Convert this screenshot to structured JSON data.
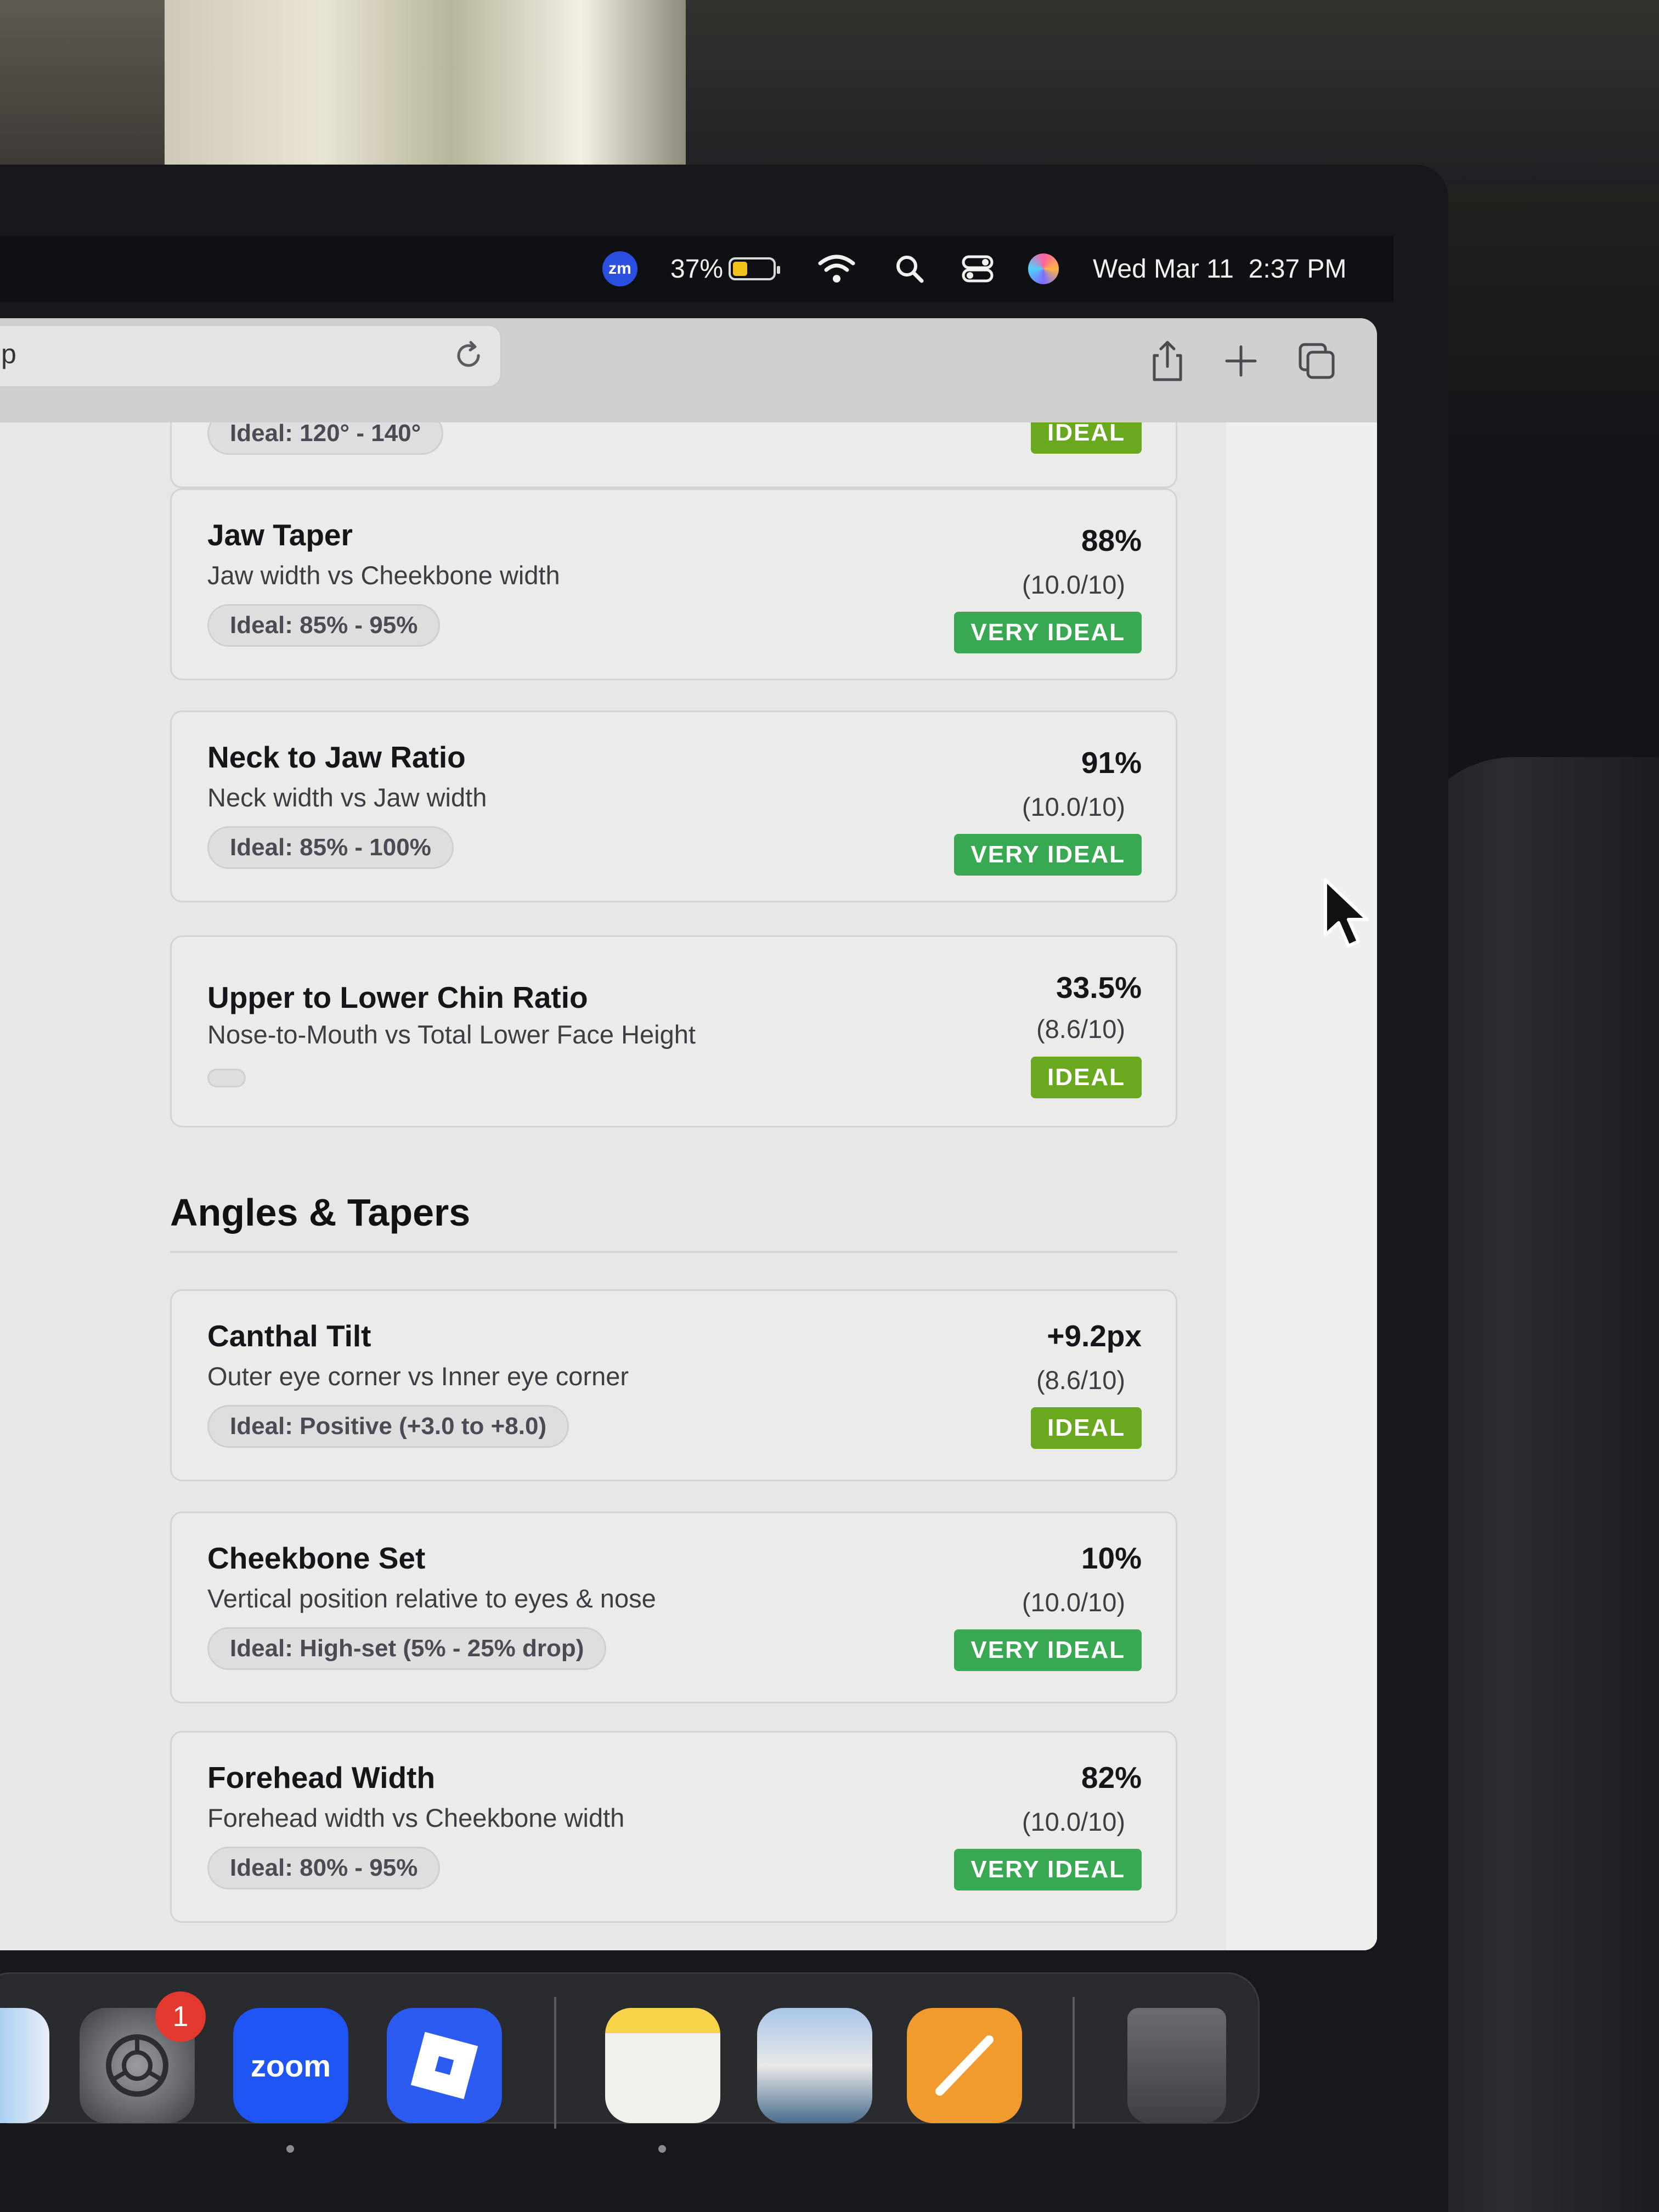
{
  "menubar": {
    "zoom_badge": "zm",
    "battery_percent": "37%",
    "battery_level": 0.37,
    "clock": "Wed Mar 11  2:37 PM",
    "icons": [
      "zoom-icon",
      "battery-icon",
      "wifi-icon",
      "search-icon",
      "control-center-icon",
      "siri-icon"
    ]
  },
  "browser": {
    "url_fragment": "p",
    "toolbar_icons": [
      "reload-icon",
      "share-icon",
      "new-tab-icon",
      "tabs-overview-icon"
    ]
  },
  "top_partial": {
    "ideal_label": "Ideal: 120° - 140°",
    "badge": "IDEAL"
  },
  "cards": [
    {
      "title": "Jaw Taper",
      "subtitle": "Jaw width vs Cheekbone width",
      "ideal": "Ideal: 85% - 95%",
      "value": "88%",
      "score": "(10.0/10)",
      "badge": "VERY IDEAL"
    },
    {
      "title": "Neck to Jaw Ratio",
      "subtitle": "Neck width vs Jaw width",
      "ideal": "Ideal: 85% - 100%",
      "value": "91%",
      "score": "(10.0/10)",
      "badge": "VERY IDEAL"
    },
    {
      "title": "Upper to Lower Chin Ratio",
      "subtitle": "Nose-to-Mouth vs Total Lower Face Height",
      "ideal": "",
      "value": "33.5%",
      "score": "(8.6/10)",
      "badge": "IDEAL"
    }
  ],
  "section": {
    "title": "Angles & Tapers"
  },
  "angle_cards": [
    {
      "title": "Canthal Tilt",
      "subtitle": "Outer eye corner vs Inner eye corner",
      "ideal": "Ideal: Positive (+3.0 to +8.0)",
      "value": "+9.2px",
      "score": "(8.6/10)",
      "badge": "IDEAL"
    },
    {
      "title": "Cheekbone Set",
      "subtitle": "Vertical position relative to eyes & nose",
      "ideal": "Ideal: High-set (5% - 25% drop)",
      "value": "10%",
      "score": "(10.0/10)",
      "badge": "VERY IDEAL"
    },
    {
      "title": "Forehead Width",
      "subtitle": "Forehead width vs Cheekbone width",
      "ideal": "Ideal: 80% - 95%",
      "value": "82%",
      "score": "(10.0/10)",
      "badge": "VERY IDEAL"
    }
  ],
  "dock": {
    "apps": [
      "Finder",
      "System Settings",
      "Zoom",
      "Roblox",
      "Notes",
      "Preview",
      "Pages",
      "Trash"
    ],
    "settings_badge": "1",
    "zoom_label": "zoom"
  },
  "colors": {
    "very_ideal": "#39a853",
    "ideal": "#6aa820",
    "page_bg": "#e7e7e5"
  }
}
